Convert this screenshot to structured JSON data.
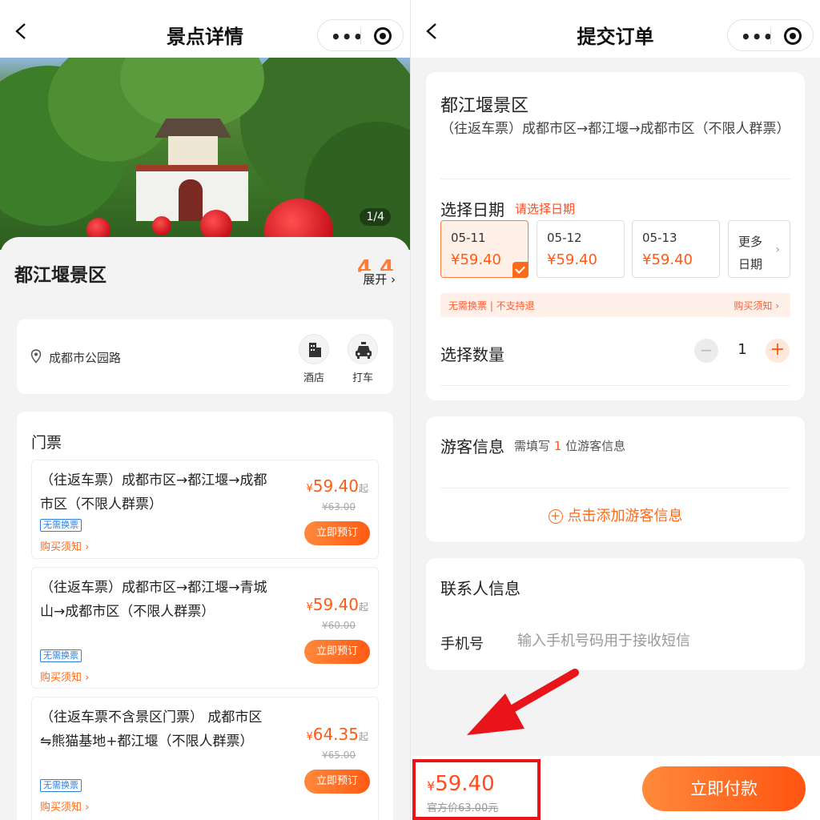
{
  "left": {
    "nav_title": "景点详情",
    "photo_counter": "1/4",
    "spot_name": "都江堰景区",
    "rating": "4.4",
    "expand_label": "展开 ›",
    "address": "成都市公园路",
    "quick_actions": [
      {
        "label": "酒店",
        "icon": "hotel-icon"
      },
      {
        "label": "打车",
        "icon": "taxi-icon"
      }
    ],
    "tickets_title": "门票",
    "tickets": [
      {
        "name": "（往返车票）成都市区→都江堰→成都市区（不限人群票）",
        "price": "59.40",
        "orig": "¥63.00",
        "tag": "无需换票",
        "notice": "购买须知 ›",
        "book": "立即预订"
      },
      {
        "name": "（往返车票）成都市区→都江堰→青城山→成都市区（不限人群票）",
        "price": "59.40",
        "orig": "¥60.00",
        "tag": "无需换票",
        "notice": "购买须知 ›",
        "book": "立即预订"
      },
      {
        "name": "（往返车票不含景区门票） 成都市区⇋熊猫基地+都江堰（不限人群票）",
        "price": "64.35",
        "orig": "¥65.00",
        "tag": "无需换票",
        "notice": "购买须知 ›",
        "book": "立即预订"
      }
    ],
    "yen": "¥",
    "qi": "起"
  },
  "right": {
    "nav_title": "提交订单",
    "spot_name": "都江堰景区",
    "ticket_desc": "（往返车票）成都市区→都江堰→成都市区（不限人群票）",
    "date_label": "选择日期",
    "date_hint": "请选择日期",
    "dates": [
      {
        "date": "05-11",
        "price": "¥59.40",
        "selected": true
      },
      {
        "date": "05-12",
        "price": "¥59.40",
        "selected": false
      },
      {
        "date": "05-13",
        "price": "¥59.40",
        "selected": false
      }
    ],
    "more_dates": "更多日期",
    "warn_left": "无需换票 | 不支持退",
    "warn_right": "购买须知 ›",
    "qty_label": "选择数量",
    "qty_minus": "−",
    "qty_value": "1",
    "qty_plus": "+",
    "visitor_title": "游客信息",
    "visitor_hint_prefix": "需填写",
    "visitor_hint_count": "1",
    "visitor_hint_suffix": "位游客信息",
    "visitor_add": "点击添加游客信息",
    "contact_title": "联系人信息",
    "phone_label": "手机号",
    "phone_placeholder": "输入手机号码用于接收短信",
    "total_yen": "¥",
    "total_price": "59.40",
    "official_price": "官方价63.00元",
    "pay_label": "立即付款"
  },
  "colors": {
    "accent": "#ff5a14",
    "highlight_box": "#e8141a",
    "arrow": "#e8141a"
  }
}
